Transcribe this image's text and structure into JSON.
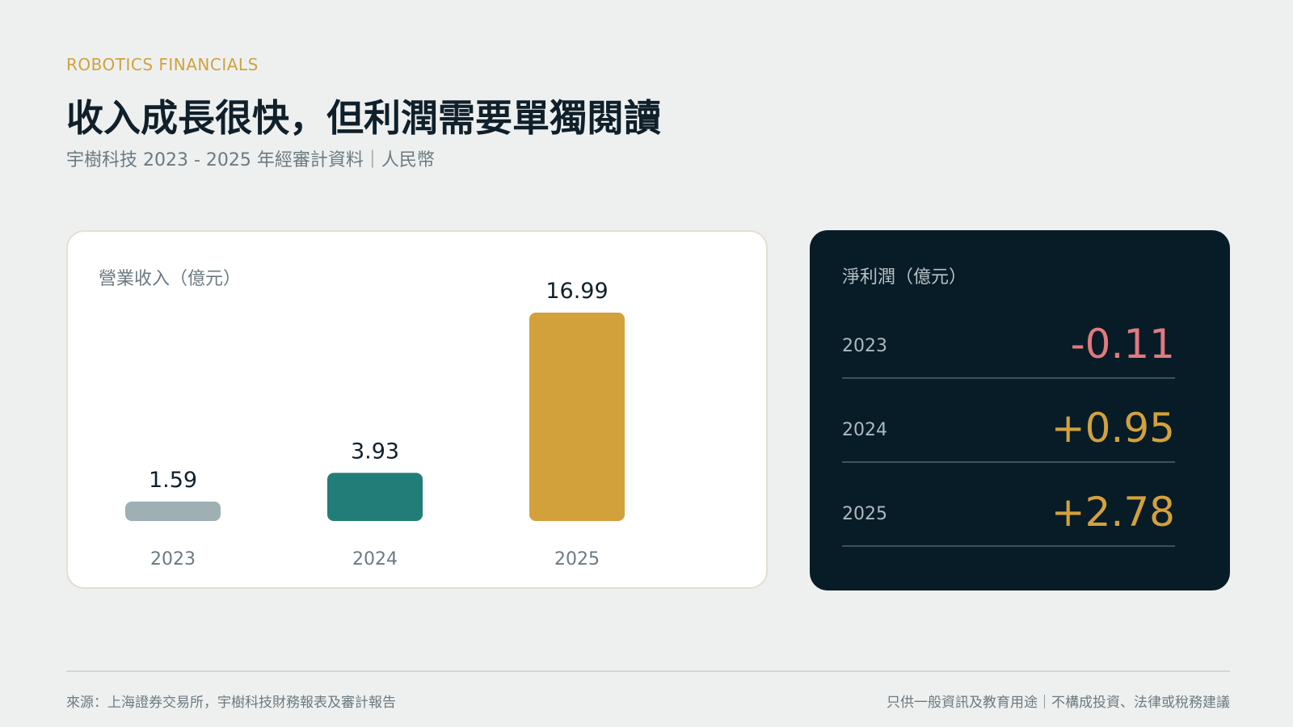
{
  "header": {
    "eyebrow": "ROBOTICS FINANCIALS",
    "title": "收入成長很快，但利潤需要單獨閱讀",
    "subtitle": "宇樹科技 2023 - 2025 年經審計資料｜人民幣"
  },
  "chart_data": {
    "type": "bar",
    "title": "營業收入（億元）",
    "categories": [
      "2023",
      "2024",
      "2025"
    ],
    "values": [
      1.59,
      3.93,
      16.99
    ],
    "value_labels": [
      "1.59",
      "3.93",
      "16.99"
    ],
    "bar_colors": [
      "#9fb0b5",
      "#227d78",
      "#d3a13c"
    ],
    "ylim": [
      0,
      16.99
    ],
    "grid": false,
    "legend": "none"
  },
  "net_profit": {
    "title": "淨利潤（億元）",
    "rows": [
      {
        "year": "2023",
        "value": "-0.11",
        "color": "#e07a7f"
      },
      {
        "year": "2024",
        "value": "+0.95",
        "color": "#d3a13c"
      },
      {
        "year": "2025",
        "value": "+2.78",
        "color": "#d3a13c"
      }
    ]
  },
  "footer": {
    "source": "來源：上海證券交易所，宇樹科技財務報表及審計報告",
    "disclaimer": "只供一般資訊及教育用途｜不構成投資、法律或稅務建議"
  }
}
